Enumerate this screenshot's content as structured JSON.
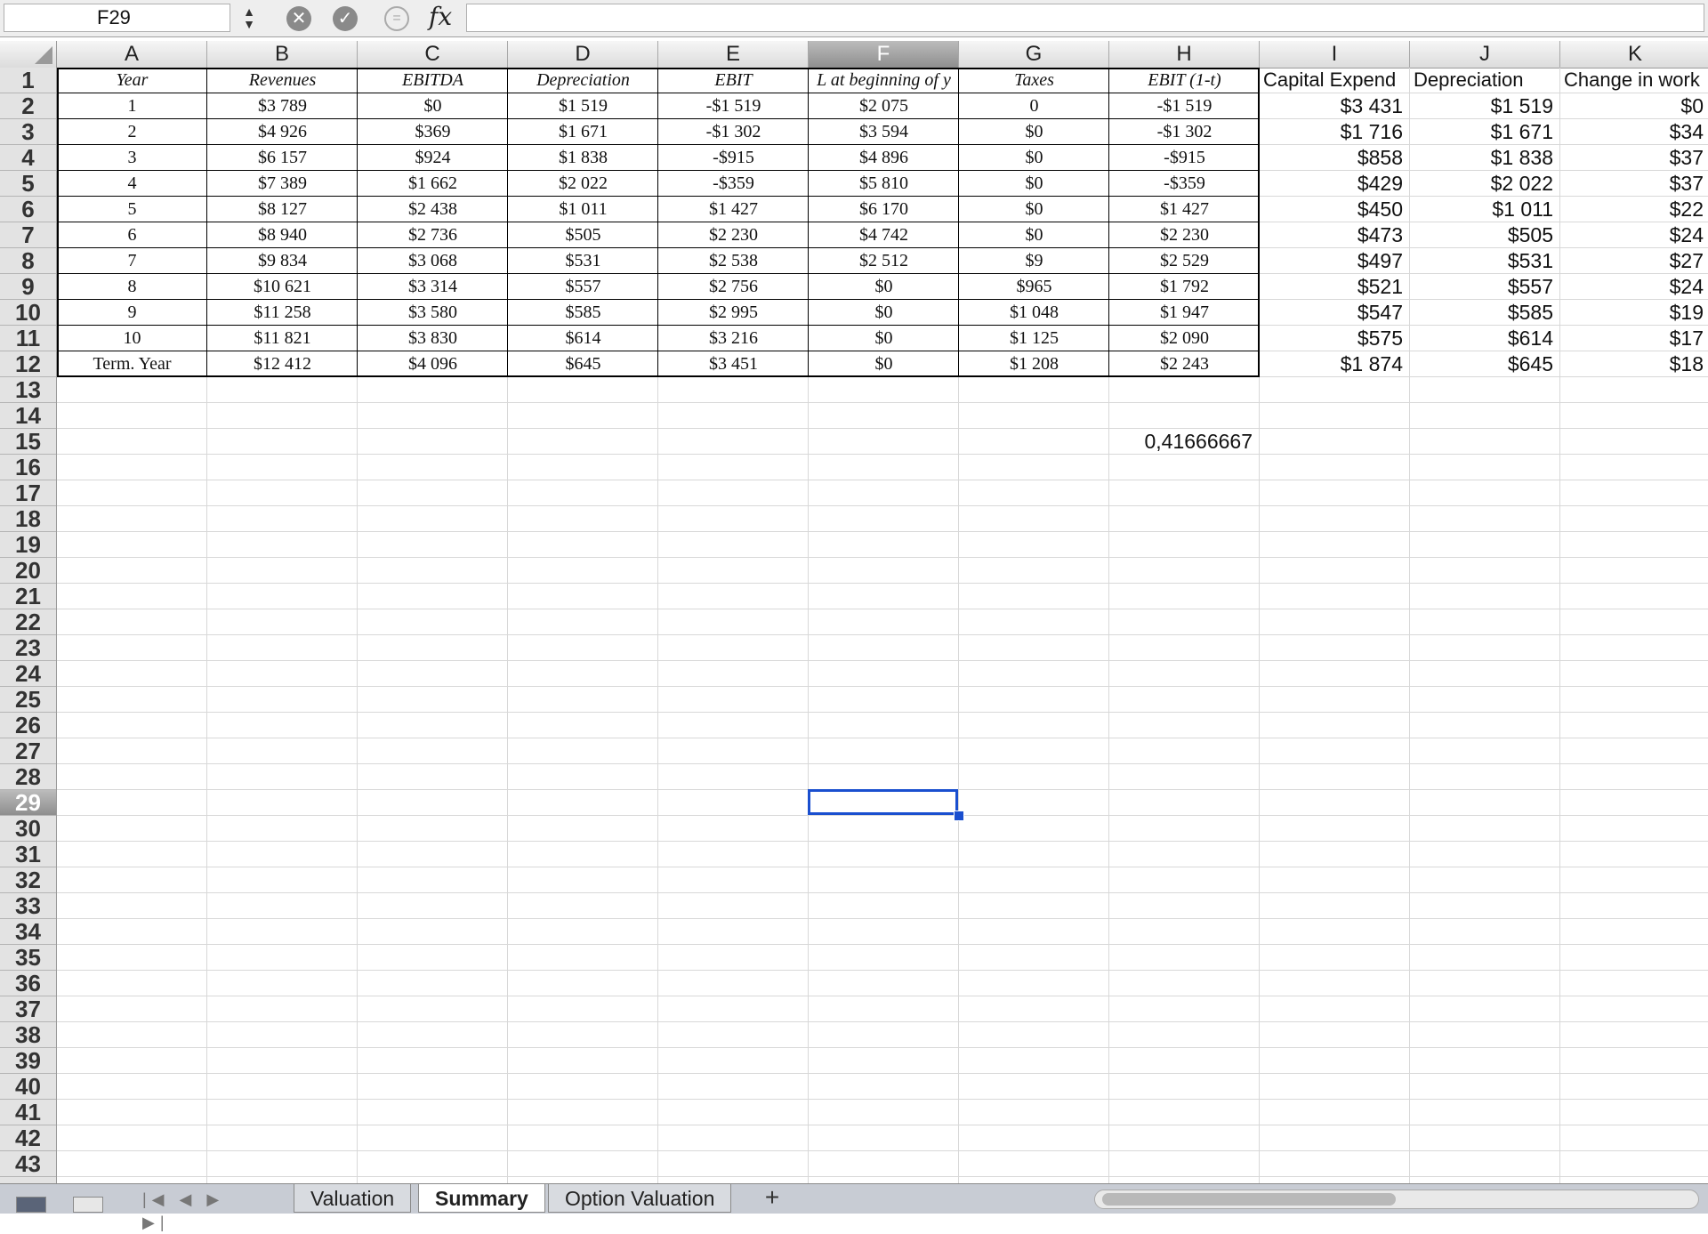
{
  "formula_bar": {
    "cell_ref": "F29",
    "fx_label": "fx",
    "stepper": "▲▼",
    "cancel": "✕",
    "confirm": "✓",
    "func": "="
  },
  "columns": [
    "A",
    "B",
    "C",
    "D",
    "E",
    "F",
    "G",
    "H",
    "I",
    "J",
    "K"
  ],
  "active_column": "F",
  "active_row": 29,
  "row_count": 43,
  "table": {
    "headers": [
      "Year",
      "Revenues",
      "EBITDA",
      "Depreciation",
      "EBIT",
      "L at beginning of y",
      "Taxes",
      "EBIT (1-t)",
      "Capital Expend",
      "Depreciation",
      "Change in work"
    ],
    "rows": [
      [
        "1",
        "$3 789",
        "$0",
        "$1 519",
        "-$1 519",
        "$2 075",
        "0",
        "-$1 519",
        "$3 431",
        "$1 519",
        "$0"
      ],
      [
        "2",
        "$4 926",
        "$369",
        "$1 671",
        "-$1 302",
        "$3 594",
        "$0",
        "-$1 302",
        "$1 716",
        "$1 671",
        "$34"
      ],
      [
        "3",
        "$6 157",
        "$924",
        "$1 838",
        "-$915",
        "$4 896",
        "$0",
        "-$915",
        "$858",
        "$1 838",
        "$37"
      ],
      [
        "4",
        "$7 389",
        "$1 662",
        "$2 022",
        "-$359",
        "$5 810",
        "$0",
        "-$359",
        "$429",
        "$2 022",
        "$37"
      ],
      [
        "5",
        "$8 127",
        "$2 438",
        "$1 011",
        "$1 427",
        "$6 170",
        "$0",
        "$1 427",
        "$450",
        "$1 011",
        "$22"
      ],
      [
        "6",
        "$8 940",
        "$2 736",
        "$505",
        "$2 230",
        "$4 742",
        "$0",
        "$2 230",
        "$473",
        "$505",
        "$24"
      ],
      [
        "7",
        "$9 834",
        "$3 068",
        "$531",
        "$2 538",
        "$2 512",
        "$9",
        "$2 529",
        "$497",
        "$531",
        "$27"
      ],
      [
        "8",
        "$10 621",
        "$3 314",
        "$557",
        "$2 756",
        "$0",
        "$965",
        "$1 792",
        "$521",
        "$557",
        "$24"
      ],
      [
        "9",
        "$11 258",
        "$3 580",
        "$585",
        "$2 995",
        "$0",
        "$1 048",
        "$1 947",
        "$547",
        "$585",
        "$19"
      ],
      [
        "10",
        "$11 821",
        "$3 830",
        "$614",
        "$3 216",
        "$0",
        "$1 125",
        "$2 090",
        "$575",
        "$614",
        "$17"
      ],
      [
        "Term. Year",
        "$12 412",
        "$4 096",
        "$645",
        "$3 451",
        "$0",
        "$1 208",
        "$2 243",
        "$1 874",
        "$645",
        "$18"
      ]
    ]
  },
  "extra_cell": {
    "ref": "H15",
    "value": "0,41666667"
  },
  "sheet_tabs": [
    {
      "label": "Valuation",
      "active": false
    },
    {
      "label": "Summary",
      "active": true
    },
    {
      "label": "Option Valuation",
      "active": false
    }
  ],
  "add_sheet": "+",
  "nav_arrows": "|◀ ◀ ▶ ▶|"
}
